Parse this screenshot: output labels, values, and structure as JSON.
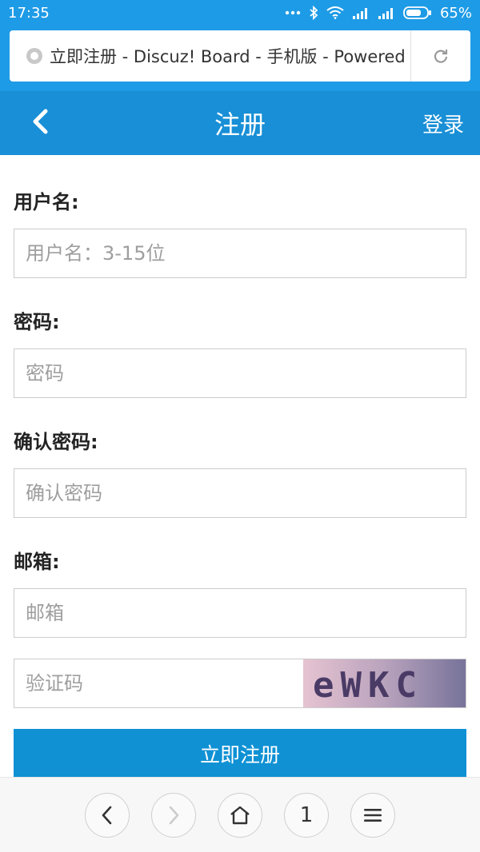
{
  "status_bar": {
    "time": "17:35",
    "battery_percent": "65%",
    "icons": [
      "more-dots-icon",
      "bluetooth-icon",
      "wifi-icon",
      "signal-icon",
      "signal-icon",
      "battery-icon"
    ]
  },
  "browser": {
    "url_title": "立即注册 - Discuz! Board - 手机版 - Powered by Discuz!",
    "reload_icon": "reload-icon",
    "site_icon": "globe-icon"
  },
  "header": {
    "title": "注册",
    "login_label": "登录",
    "back_icon": "chevron-left-icon"
  },
  "form": {
    "username": {
      "label": "用户名:",
      "placeholder": "用户名：3-15位"
    },
    "password": {
      "label": "密码:",
      "placeholder": "密码"
    },
    "confirm_password": {
      "label": "确认密码:",
      "placeholder": "确认密码"
    },
    "email": {
      "label": "邮箱:",
      "placeholder": "邮箱"
    },
    "captcha": {
      "placeholder": "验证码",
      "image_text": "eWKC"
    },
    "submit_label": "立即注册"
  },
  "bottom_nav": {
    "tab_count": "1",
    "icons": [
      "back-arrow-icon",
      "forward-arrow-icon",
      "home-icon",
      "tabs-icon",
      "menu-icon"
    ]
  },
  "colors": {
    "status_bg": "#1e9be6",
    "header_bg": "#188fd6",
    "button_bg": "#0f91d4"
  }
}
